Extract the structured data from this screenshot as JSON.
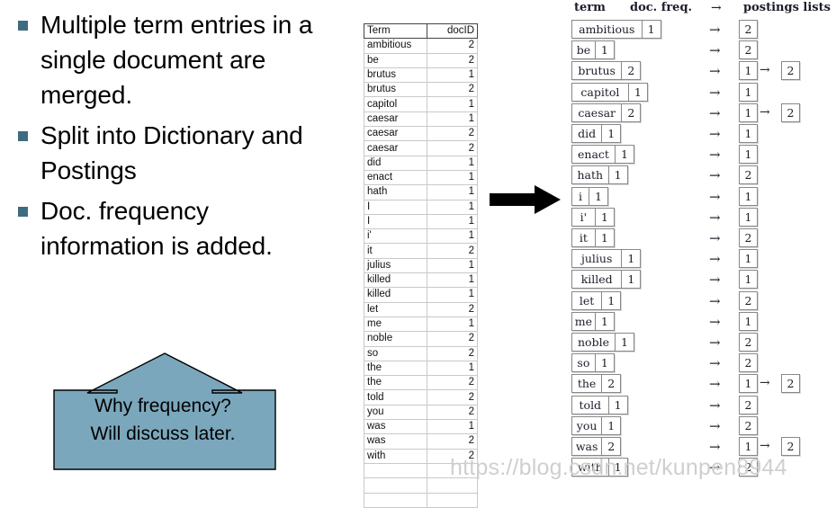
{
  "slide": {
    "bullets": [
      "Multiple term entries in a single document are merged.",
      "Split into Dictionary and Postings",
      "Doc. frequency information is added."
    ],
    "callout": {
      "line1": "Why frequency?",
      "line2": "Will discuss later.",
      "fill_color": "#7ba7bc",
      "stroke_color": "#000000"
    },
    "bullet_marker_color": "#3e6b80",
    "transform_arrow": "right-arrow",
    "watermark": "https://blog.csdn.net/kunpen8944"
  },
  "sorted_table": {
    "columns": [
      "Term",
      "docID"
    ],
    "rows": [
      [
        "ambitious",
        "2"
      ],
      [
        "be",
        "2"
      ],
      [
        "brutus",
        "1"
      ],
      [
        "brutus",
        "2"
      ],
      [
        "capitol",
        "1"
      ],
      [
        "caesar",
        "1"
      ],
      [
        "caesar",
        "2"
      ],
      [
        "caesar",
        "2"
      ],
      [
        "did",
        "1"
      ],
      [
        "enact",
        "1"
      ],
      [
        "hath",
        "1"
      ],
      [
        "I",
        "1"
      ],
      [
        "I",
        "1"
      ],
      [
        "i'",
        "1"
      ],
      [
        "it",
        "2"
      ],
      [
        "julius",
        "1"
      ],
      [
        "killed",
        "1"
      ],
      [
        "killed",
        "1"
      ],
      [
        "let",
        "2"
      ],
      [
        "me",
        "1"
      ],
      [
        "noble",
        "2"
      ],
      [
        "so",
        "2"
      ],
      [
        "the",
        "1"
      ],
      [
        "the",
        "2"
      ],
      [
        "told",
        "2"
      ],
      [
        "you",
        "2"
      ],
      [
        "was",
        "1"
      ],
      [
        "was",
        "2"
      ],
      [
        "with",
        "2"
      ],
      [
        "",
        ""
      ],
      [
        "",
        ""
      ],
      [
        "",
        ""
      ]
    ]
  },
  "inverted_index": {
    "headers": {
      "term": "term",
      "doc_freq": "doc. freq.",
      "arrow": "→",
      "postings": "postings lists"
    },
    "row_arrow": "→",
    "postings_link": "→",
    "entries": [
      {
        "term": "ambitious",
        "freq": "1",
        "postings": [
          "2"
        ]
      },
      {
        "term": "be",
        "freq": "1",
        "postings": [
          "2"
        ]
      },
      {
        "term": "brutus",
        "freq": "2",
        "postings": [
          "1",
          "2"
        ]
      },
      {
        "term": "capitol",
        "freq": "1",
        "postings": [
          "1"
        ]
      },
      {
        "term": "caesar",
        "freq": "2",
        "postings": [
          "1",
          "2"
        ]
      },
      {
        "term": "did",
        "freq": "1",
        "postings": [
          "1"
        ]
      },
      {
        "term": "enact",
        "freq": "1",
        "postings": [
          "1"
        ]
      },
      {
        "term": "hath",
        "freq": "1",
        "postings": [
          "2"
        ]
      },
      {
        "term": "i",
        "freq": "1",
        "postings": [
          "1"
        ]
      },
      {
        "term": "i'",
        "freq": "1",
        "postings": [
          "1"
        ]
      },
      {
        "term": "it",
        "freq": "1",
        "postings": [
          "2"
        ]
      },
      {
        "term": "julius",
        "freq": "1",
        "postings": [
          "1"
        ]
      },
      {
        "term": "killed",
        "freq": "1",
        "postings": [
          "1"
        ]
      },
      {
        "term": "let",
        "freq": "1",
        "postings": [
          "2"
        ]
      },
      {
        "term": "me",
        "freq": "1",
        "postings": [
          "1"
        ]
      },
      {
        "term": "noble",
        "freq": "1",
        "postings": [
          "2"
        ]
      },
      {
        "term": "so",
        "freq": "1",
        "postings": [
          "2"
        ]
      },
      {
        "term": "the",
        "freq": "2",
        "postings": [
          "1",
          "2"
        ]
      },
      {
        "term": "told",
        "freq": "1",
        "postings": [
          "2"
        ]
      },
      {
        "term": "you",
        "freq": "1",
        "postings": [
          "2"
        ]
      },
      {
        "term": "was",
        "freq": "2",
        "postings": [
          "1",
          "2"
        ]
      },
      {
        "term": "with",
        "freq": "1",
        "postings": [
          "2"
        ]
      }
    ]
  }
}
